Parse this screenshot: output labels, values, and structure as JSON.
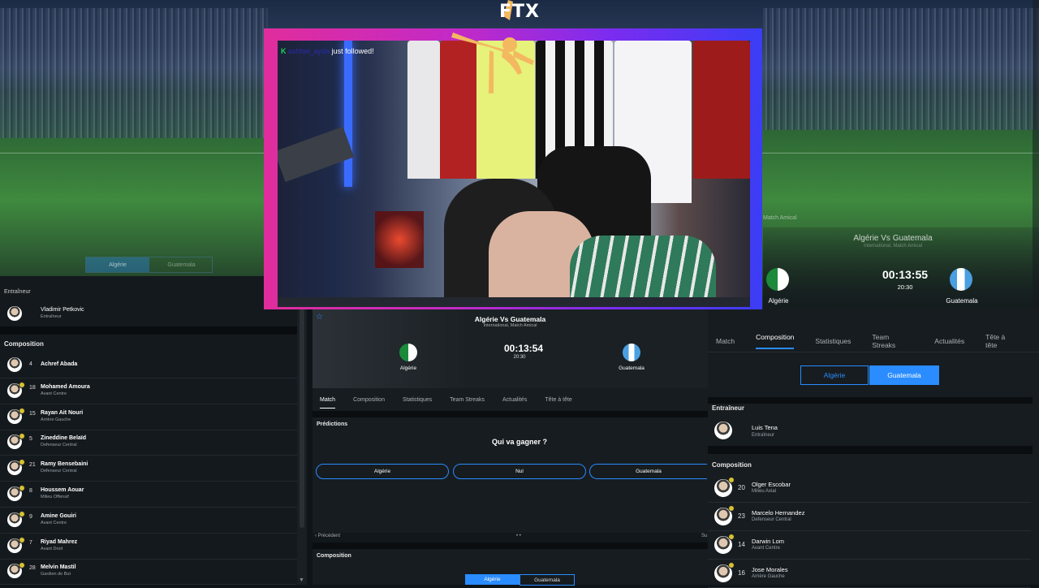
{
  "overlay": {
    "logo_text": "FTX",
    "follow_user": "ashbel_ayda",
    "follow_message": "just followed!"
  },
  "left_panel": {
    "coach_section_label": "Entraîneur",
    "coach": {
      "name": "Vladimir Petkovic",
      "role": "Entraîneur"
    },
    "composition_label": "Composition",
    "players": [
      {
        "number": "4",
        "name": "Achref Abada",
        "role": ""
      },
      {
        "number": "18",
        "name": "Mohamed Amoura",
        "role": "Avant Centre"
      },
      {
        "number": "15",
        "name": "Rayan Ait Nouri",
        "role": "Arrière Gauche"
      },
      {
        "number": "5",
        "name": "Zineddine Belaïd",
        "role": "Defenseur Central"
      },
      {
        "number": "21",
        "name": "Ramy Bensebaini",
        "role": "Defenseur Central"
      },
      {
        "number": "8",
        "name": "Houssem Aouar",
        "role": "Milieu Offensif"
      },
      {
        "number": "9",
        "name": "Amine Gouiri",
        "role": "Avant Centre"
      },
      {
        "number": "7",
        "name": "Riyad Mahrez",
        "role": "Avant Droit"
      },
      {
        "number": "28",
        "name": "Melvin Mastil",
        "role": "Gardien de But"
      }
    ],
    "team_toggle": {
      "left": "Algérie",
      "right": "Guatemala"
    }
  },
  "center_panel": {
    "match_title": "Algérie Vs Guatemala",
    "match_subtitle": "International, Match Amical",
    "home_team": "Algérie",
    "away_team": "Guatemala",
    "clock": "00:13:54",
    "kickoff": "20:30",
    "tabs": [
      "Match",
      "Composition",
      "Statistiques",
      "Team Streaks",
      "Actualités",
      "Tête à tête"
    ],
    "active_tab": "Match",
    "predictions_label": "Prédictions",
    "prediction_question": "Qui va gagner ?",
    "prediction_options": [
      "Algérie",
      "Nul",
      "Guatemala"
    ],
    "prev_label": "‹ Précédent",
    "next_label": "Su",
    "composition_label": "Composition",
    "composition_toggle": {
      "left": "Algérie",
      "right": "Guatemala"
    }
  },
  "right_panel": {
    "friendly_label": "Match Amical",
    "match_title": "Algérie Vs Guatemala",
    "match_subtitle": "International, Match Amical",
    "home_team": "Algérie",
    "away_team": "Guatemala",
    "clock": "00:13:55",
    "kickoff": "20:30",
    "tabs": [
      "Match",
      "Composition",
      "Statistiques",
      "Team Streaks",
      "Actualités",
      "Tête à tête"
    ],
    "active_tab": "Composition",
    "team_toggle": {
      "left": "Algérie",
      "right": "Guatemala",
      "active": "Guatemala"
    },
    "coach_section_label": "Entraîneur",
    "coach": {
      "name": "Luis Tena",
      "role": "Entraîneur"
    },
    "composition_label": "Composition",
    "players": [
      {
        "number": "20",
        "name": "Olger Escobar",
        "role": "Milieu Axial"
      },
      {
        "number": "23",
        "name": "Marcelo Hernandez",
        "role": "Defenseur Central"
      },
      {
        "number": "14",
        "name": "Darwin Lom",
        "role": "Avant Centre"
      },
      {
        "number": "16",
        "name": "Jose Morales",
        "role": "Arrière Gauche"
      }
    ]
  },
  "colors": {
    "accent": "#2a8cff",
    "frame_start": "#e02d9c",
    "frame_end": "#3b3df5",
    "panel": "#14191d"
  }
}
